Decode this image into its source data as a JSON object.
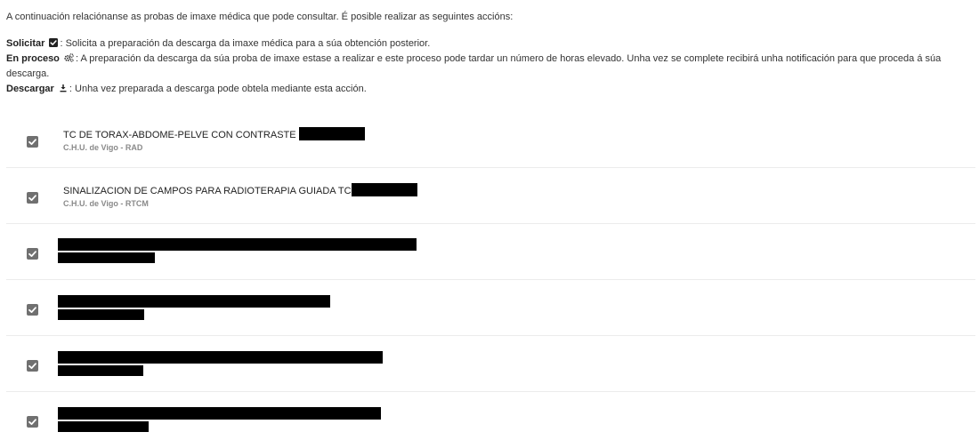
{
  "intro": "A continuación relaciónanse as probas de imaxe médica que pode consultar. É posible realizar as seguintes accións:",
  "legend": {
    "solicitar": {
      "label": "Solicitar",
      "icon": "checkbox-icon",
      "text": ": Solicita a preparación da descarga da imaxe médica para a súa obtención posterior."
    },
    "en_proceso": {
      "label": "En proceso",
      "icon": "gears-icon",
      "text": ": A preparación da descarga da súa proba de imaxe estase a realizar e este proceso pode tardar un número de horas elevado. Unha vez se complete recibirá unha notificación para que proceda á súa descarga."
    },
    "descargar": {
      "label": "Descargar",
      "icon": "download-icon",
      "text": ": Unha vez preparada a descarga pode obtela mediante esta acción."
    }
  },
  "studies": [
    {
      "title": "TC DE TORAX-ABDOME-PELVE CON CONTRASTE",
      "subtitle": "C.H.U. de Vigo - RAD",
      "checked": true
    },
    {
      "title": "SINALIZACION DE CAMPOS PARA RADIOTERAPIA GUIADA TC",
      "subtitle": "C.H.U. de Vigo - RTCM",
      "checked": true
    },
    {
      "title": "",
      "subtitle": "",
      "checked": true
    },
    {
      "title": "",
      "subtitle": "",
      "checked": true
    },
    {
      "title": "",
      "subtitle": "",
      "checked": true
    },
    {
      "title": "",
      "subtitle": "",
      "checked": true
    }
  ],
  "colors": {
    "checkbox": "#707070",
    "subtitle": "#8a8a8a",
    "divider": "#ececec",
    "redaction": "#000000"
  }
}
